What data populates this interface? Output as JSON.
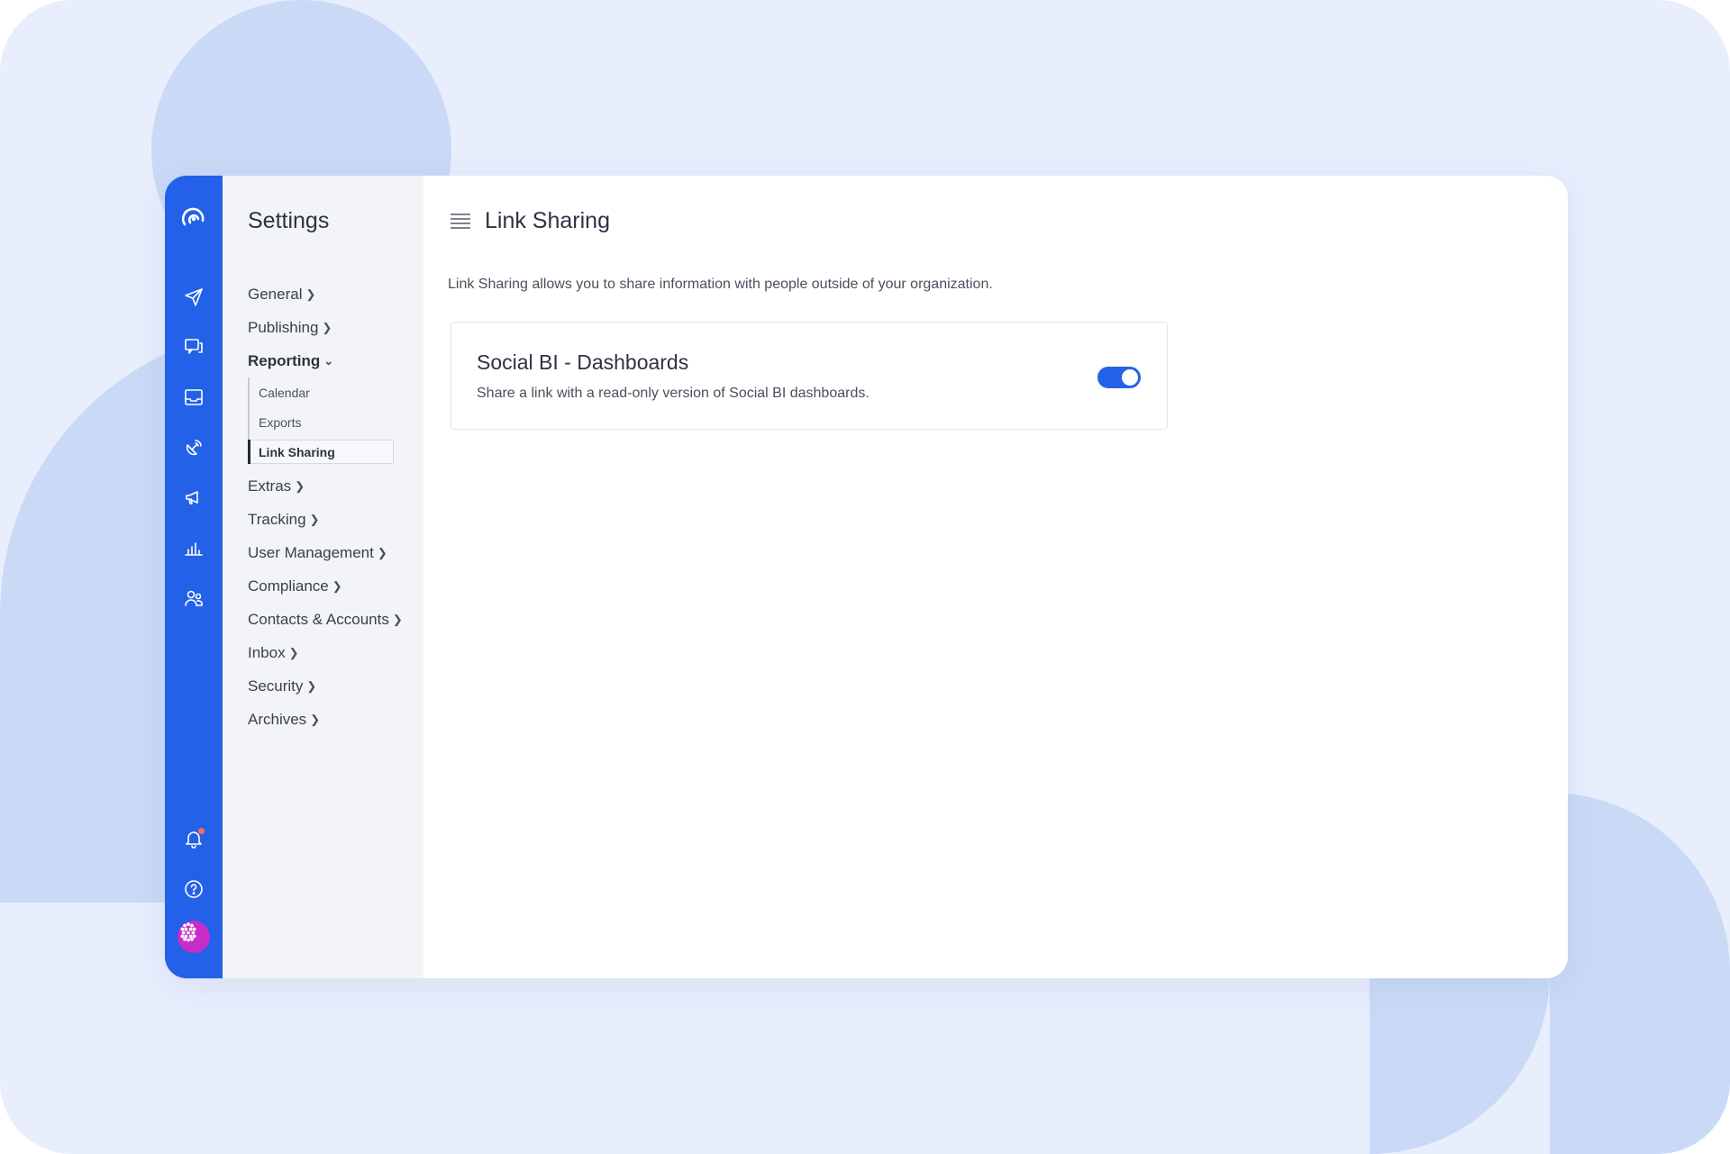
{
  "sidebar": {
    "title": "Settings",
    "items": [
      {
        "label": "General"
      },
      {
        "label": "Publishing"
      },
      {
        "label": "Reporting",
        "open": true,
        "children": [
          {
            "label": "Calendar"
          },
          {
            "label": "Exports"
          },
          {
            "label": "Link Sharing",
            "active": true
          }
        ]
      },
      {
        "label": "Extras"
      },
      {
        "label": "Tracking"
      },
      {
        "label": "User Management"
      },
      {
        "label": "Compliance"
      },
      {
        "label": "Contacts & Accounts"
      },
      {
        "label": "Inbox"
      },
      {
        "label": "Security"
      },
      {
        "label": "Archives"
      }
    ]
  },
  "rail": {
    "icons": [
      "logo-icon",
      "send-icon",
      "messages-icon",
      "inbox-icon",
      "listening-icon",
      "megaphone-icon",
      "reports-icon",
      "people-icon",
      "bell-icon",
      "help-icon"
    ],
    "notification_dot": true
  },
  "main": {
    "title": "Link Sharing",
    "description": "Link Sharing allows you to share information with people outside of your organization.",
    "card": {
      "title": "Social BI - Dashboards",
      "subtitle": "Share a link with a read-only version of Social BI dashboards.",
      "toggle_on": true
    }
  },
  "colors": {
    "rail": "#2361e8",
    "accent": "#2361e8",
    "background": "#e8eefc",
    "blob": "#cad9f6",
    "notification": "#ff6b57",
    "avatar": "#c72cc9"
  }
}
